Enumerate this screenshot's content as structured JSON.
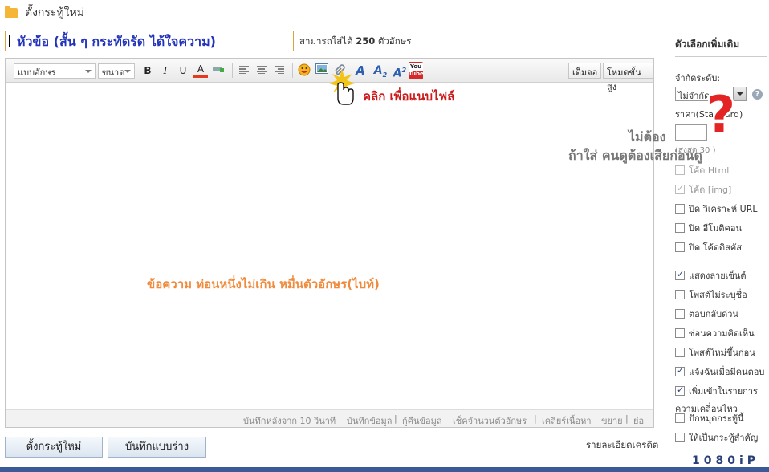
{
  "header": {
    "title": "ตั้งกระทู้ใหม่"
  },
  "title_input": {
    "value": "หัวข้อ (สั้น ๆ กระทัดรัด ได้ใจความ)"
  },
  "limit_text": {
    "prefix": "สามารถใส่ได้",
    "count": "250",
    "suffix": "ตัวอักษร"
  },
  "toolbar": {
    "font_label": "แบบอักษร",
    "size_label": "ขนาด",
    "bold": "B",
    "italic": "I",
    "underline": "U",
    "font_color": "A",
    "youtube": "You\nTube",
    "fit_label": "เต็มจอ",
    "advanced_label": "โหมดขั้นสูง"
  },
  "annotations": {
    "attach_hint": "คลิก เพื่อแนบไฟล์",
    "body_hint": "ข้อความ ท่อนหนึ่งไม่เกิน หมื่นตัวอักษร(ไบท์)",
    "price_note1": "ไม่ต้อง",
    "price_note2": "ถ้าใส่ คนดูต้องเสียก่อนดู"
  },
  "statusbar": {
    "autosave": "บันทึกหลังจาก 10 วินาที",
    "save_data": "บันทึกข้อมูล",
    "restore": "กู้คืนข้อมูล",
    "count_chars": "เช็คจำนวนตัวอักษร",
    "clear": "เคลียร์เนื้อหา",
    "expand": "ขยาย",
    "shrink": "ย่อ"
  },
  "buttons": {
    "post": "ตั้งกระทู้ใหม่",
    "draft": "บันทึกแบบร่าง"
  },
  "credit_details": "รายละเอียดเครดิต",
  "brand": "1080iP",
  "options": {
    "title": "ตัวเลือกเพิ่มเติม",
    "limit_label": "จำกัดระดับ:",
    "limit_value": "ไม่จำกัด",
    "price_label": "ราคา(Standard)",
    "price_hint": "(สูงสุด 30 )",
    "checkboxes": [
      {
        "label": "โค้ด Html",
        "checked": false,
        "disabled": true
      },
      {
        "label": "โค้ด [img]",
        "checked": true,
        "disabled": true
      },
      {
        "label": "ปิด วิเคราะห์ URL",
        "checked": false,
        "disabled": false
      },
      {
        "label": "ปิด อีโมติคอน",
        "checked": false,
        "disabled": false
      },
      {
        "label": "ปิด โค้ดดิสคัส",
        "checked": false,
        "disabled": false
      },
      {
        "label": "แสดงลายเซ็นต์",
        "checked": true,
        "disabled": false
      },
      {
        "label": "โพสต์ไม่ระบุชื่อ",
        "checked": false,
        "disabled": false
      },
      {
        "label": "ตอบกลับด่วน",
        "checked": false,
        "disabled": false
      },
      {
        "label": "ซ่อนความคิดเห็น",
        "checked": false,
        "disabled": false
      },
      {
        "label": "โพสต์ใหม่ขึ้นก่อน",
        "checked": false,
        "disabled": false
      },
      {
        "label": "แจ้งฉันเมื่อมีคนตอบ",
        "checked": true,
        "disabled": false
      },
      {
        "label": "เพิ่มเข้าในรายการ",
        "checked": true,
        "disabled": false
      },
      {
        "label": "ปักหมุดกระทู้นี้",
        "checked": false,
        "disabled": false
      },
      {
        "label": "ให้เป็นกระทู้สำคัญ",
        "checked": false,
        "disabled": false
      }
    ],
    "feed_label_line2": "ความเคลื่อนไหว"
  }
}
